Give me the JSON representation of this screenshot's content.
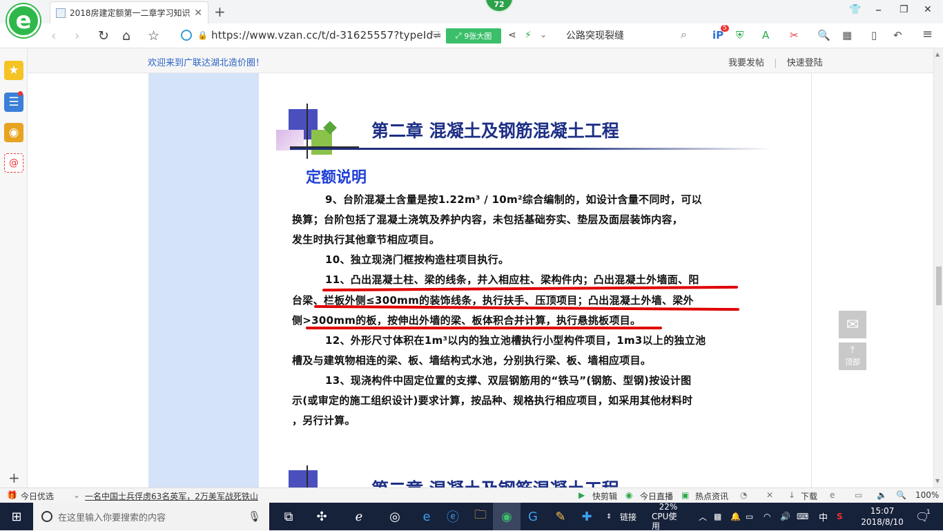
{
  "browser": {
    "tab_title": "2018房建定额第一二章学习知识",
    "tab_close": "✕",
    "new_tab": "+",
    "badge": "72",
    "url": "https://www.vzan.cc/t/d-31625557?typeId=",
    "big_pic_label": "9张大图",
    "search_text": "公路突现裂缝",
    "tool_badge": "5"
  },
  "site": {
    "welcome": "欢迎来到广联达湖北造价圈！",
    "post_link": "我要发帖",
    "sep": "|",
    "login_link": "快速登陆"
  },
  "slide": {
    "title": "第二章  混凝土及钢筋混凝土工程",
    "subtitle": "定额说明",
    "lines": [
      "9、台阶混凝土含量是按1.22m³ / 10m²综合编制的，如设计含量不同时，可以",
      "换算；台阶包括了混凝土浇筑及养护内容，未包括基础夯实、垫层及面层装饰内容，",
      "发生时执行其他章节相应项目。",
      "10、独立现浇门框按构造柱项目执行。",
      "11、凸出混凝土柱、梁的线条，并入相应柱、梁构件内；凸出混凝土外墙面、阳",
      "台梁、栏板外侧≤300mm的装饰线条，执行扶手、压顶项目；凸出混凝土外墙、梁外",
      "侧>300mm的板，按伸出外墙的梁、板体积合并计算，执行悬挑板项目。",
      "12、外形尺寸体积在1m³以内的独立池槽执行小型构件项目，1m3以上的独立池",
      "槽及与建筑物相连的梁、板、墙结构式水池，分别执行梁、板、墙相应项目。",
      "13、现浇构件中固定位置的支撑、双层钢筋用的“铁马”(钢筋、型钢)按设计图",
      "示(或审定的施工组织设计)要求计算，按品种、规格执行相应项目，如采用其他材料时",
      "，另行计算。"
    ],
    "next_title": "第二章  混凝土及钢筋混凝土工程"
  },
  "floating": {
    "totop_label": "顶部"
  },
  "status": {
    "today_pick": "今日优选",
    "news": "一名中国士兵俘虏63名英军，2万美军战死铁山",
    "quick_clip": "快剪辑",
    "live": "今日直播",
    "hot_news": "热点资讯",
    "download": "下载",
    "zoom": "100%"
  },
  "taskbar": {
    "search_placeholder": "在这里输入你要搜索的内容",
    "link_label": "链接",
    "cpu_percent": "22%",
    "cpu_label": "CPU使用",
    "ime": "中",
    "time": "15:07",
    "date": "2018/8/10",
    "notif_count": "1"
  },
  "colors": {
    "heading_blue": "#1d2f86",
    "subhead_blue": "#1f3fd6",
    "highlight_red": "#e00000",
    "sidebar_blue": "#d4e3f8"
  }
}
